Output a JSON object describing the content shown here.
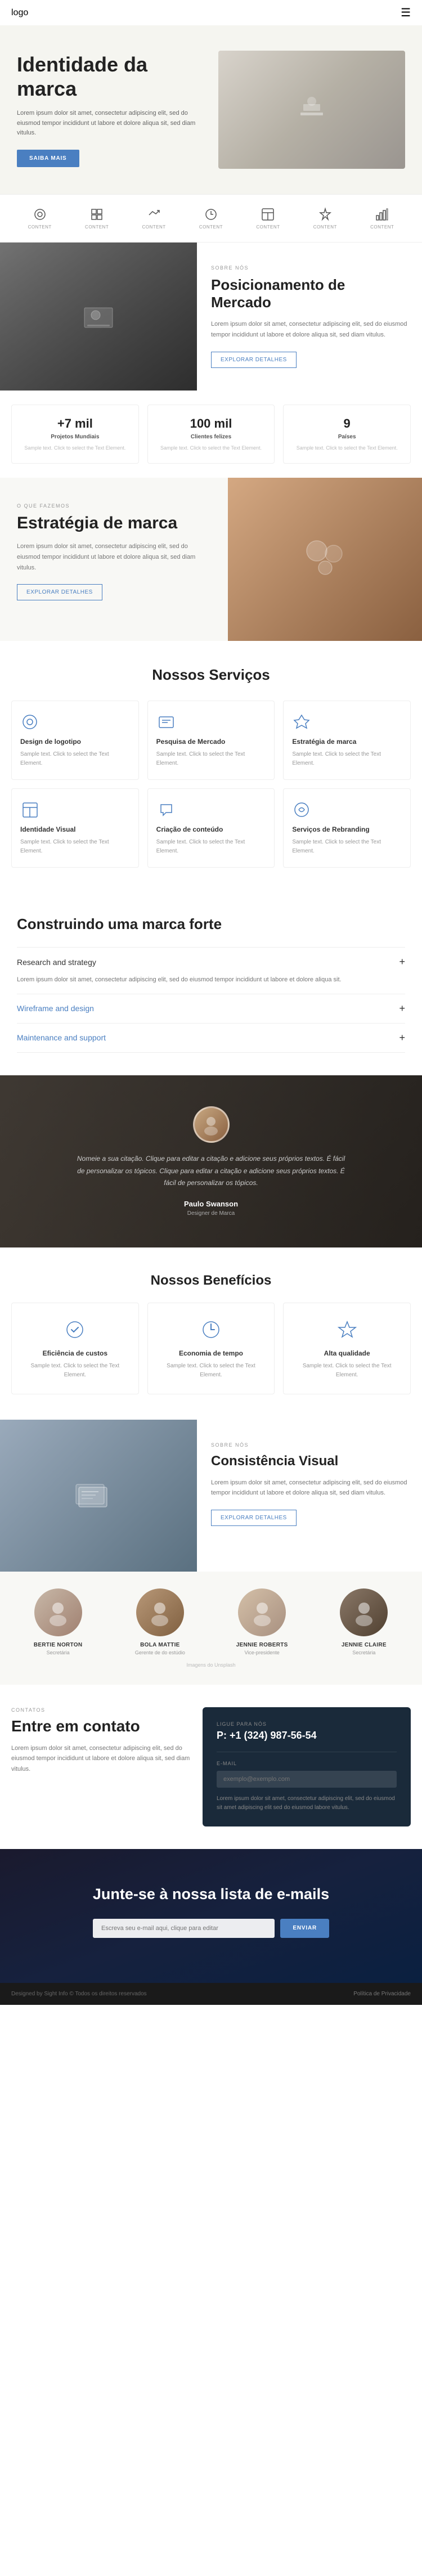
{
  "nav": {
    "logo": "logo",
    "menu_icon": "☰"
  },
  "hero": {
    "title": "Identidade da marca",
    "description": "Lorem ipsum dolor sit amet, consectetur adipiscing elit, sed do eiusmod tempor incididunt ut labore et dolore aliqua sit, sed diam vitulus.",
    "button": "SAIBA MAIS"
  },
  "icons_row": [
    {
      "id": "camera",
      "label": "CONTENT",
      "unicode": "⊙"
    },
    {
      "id": "book",
      "label": "CONTENT",
      "unicode": "⊞"
    },
    {
      "id": "check",
      "label": "CONTENT",
      "unicode": "✓"
    },
    {
      "id": "clock",
      "label": "CONTENT",
      "unicode": "◎"
    },
    {
      "id": "grid",
      "label": "CONTENT",
      "unicode": "⊡"
    },
    {
      "id": "bolt",
      "label": "CONTENT",
      "unicode": "⚡"
    },
    {
      "id": "chart",
      "label": "CONTENT",
      "unicode": "⊟"
    }
  ],
  "about": {
    "label": "SOBRE NÓS",
    "title": "Posicionamento de Mercado",
    "description": "Lorem ipsum dolor sit amet, consectetur adipiscing elit, sed do eiusmod tempor incididunt ut labore et dolore aliqua sit, sed diam vitulus.",
    "button": "EXPLORAR DETALHES"
  },
  "stats": [
    {
      "number": "+7 mil",
      "label": "Projetos Mundiais",
      "description": "Sample text. Click to select the Text Element."
    },
    {
      "number": "100 mil",
      "label": "Clientes felizes",
      "description": "Sample text. Click to select the Text Element."
    },
    {
      "number": "9",
      "label": "Países",
      "description": "Sample text. Click to select the Text Element."
    }
  ],
  "strategy": {
    "label": "O QUE FAZEMOS",
    "title": "Estratégia de marca",
    "description": "Lorem ipsum dolor sit amet, consectetur adipiscing elit, sed do eiusmod tempor incididunt ut labore et dolore aliqua sit, sed diam vitulus.",
    "button": "EXPLORAR DETALHES"
  },
  "services": {
    "title": "Nossos Serviços",
    "items": [
      {
        "title": "Design de logotipo",
        "description": "Sample text. Click to select the Text Element."
      },
      {
        "title": "Pesquisa de Mercado",
        "description": "Sample text. Click to select the Text Element."
      },
      {
        "title": "Estratégia de marca",
        "description": "Sample text. Click to select the Text Element."
      },
      {
        "title": "Identidade Visual",
        "description": "Sample text. Click to select the Text Element."
      },
      {
        "title": "Criação de conteúdo",
        "description": "Sample text. Click to select the Text Element."
      },
      {
        "title": "Serviços de Rebranding",
        "description": "Sample text. Click to select the Text Element."
      }
    ]
  },
  "building": {
    "title": "Construindo uma marca forte",
    "accordion": [
      {
        "header": "Research and strategy",
        "content": "Lorem ipsum dolor sit amet, consectetur adipiscing elit, sed do eiusmod tempor incididunt ut labore et dolore aliqua sit.",
        "open": true
      },
      {
        "header": "Wireframe and design",
        "content": "",
        "open": false
      },
      {
        "header": "Maintenance and support",
        "content": "",
        "open": false
      }
    ]
  },
  "testimonial": {
    "text": "Nomeie a sua citação. Clique para editar a citação e adicione seus próprios textos. É fácil de personalizar os tópicos. Clique para editar a citação e adicione seus próprios textos. É fácil de personalizar os tópicos.",
    "name": "Paulo Swanson",
    "role": "Designer de Marca"
  },
  "benefits": {
    "title": "Nossos Benefícios",
    "items": [
      {
        "title": "Eficiência de custos",
        "description": "Sample text. Click to select the Text Element."
      },
      {
        "title": "Economia de tempo",
        "description": "Sample text. Click to select the Text Element."
      },
      {
        "title": "Alta qualidade",
        "description": "Sample text. Click to select the Text Element."
      }
    ]
  },
  "consistency": {
    "label": "SOBRE NÓS",
    "title": "Consistência Visual",
    "description": "Lorem ipsum dolor sit amet, consectetur adipiscing elit, sed do eiusmod tempor incididunt ut labore et dolore aliqua sit, sed diam vitulus.",
    "button": "EXPLORAR DETALHES"
  },
  "team": {
    "members": [
      {
        "name": "BERTIE NORTON",
        "role": "Secretária",
        "color": "#c8a882"
      },
      {
        "name": "BOLA MATTIE",
        "role": "Gerente de do estúdio",
        "color": "#a07850"
      },
      {
        "name": "JENNIE ROBERTS",
        "role": "Vice-presidente",
        "color": "#c4b098"
      },
      {
        "name": "JENNIE CLAIRE",
        "role": "Secretária",
        "color": "#8a6b50"
      }
    ],
    "footer": "Imagens do Unsplash"
  },
  "contact": {
    "label": "CONTATOS",
    "title": "Entre em contato",
    "description": "Lorem ipsum dolor sit amet, consectetur adipiscing elit, sed do eiusmod tempor incididunt ut labore et dolore aliqua sit, sed diam vitulus.",
    "right": {
      "phone_label": "LIGUE PARA NÓS",
      "phone": "P: +1 (324) 987-56-54",
      "email_label": "E-MAIL",
      "email_placeholder": "exemplo@exemplo.com",
      "email_note": "Lorem ipsum dolor sit amet, consectetur adipiscing elit, sed do eiusmod sit amet adipiscing elit sed do eiusmod labore vitulus."
    }
  },
  "email_signup": {
    "title": "Junte-se à nossa lista de e-mails",
    "input_placeholder": "Escreva seu e-mail aqui, clique para editar",
    "button": "ENVIAR"
  },
  "footer": {
    "copyright": "Designed by Sight Info © Todos os direitos reservados",
    "link": "Política de Privacidade"
  }
}
